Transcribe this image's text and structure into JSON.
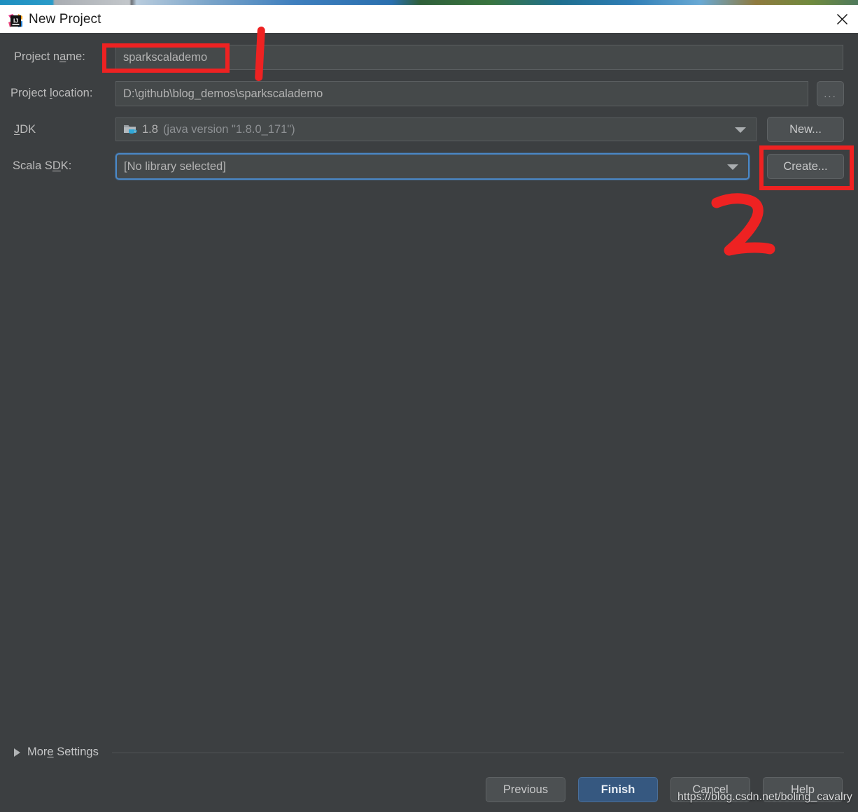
{
  "window": {
    "title": "New Project",
    "icon": "intellij-idea-logo",
    "close_icon": "close-icon"
  },
  "form": {
    "project_name": {
      "label_before": "Project n",
      "label_mnemonic": "a",
      "label_after": "me:",
      "value": "sparkscalademo"
    },
    "project_location": {
      "label_before": "Project ",
      "label_mnemonic": "l",
      "label_after": "ocation:",
      "value": "D:\\github\\blog_demos\\sparkscalademo",
      "browse_label": "..."
    },
    "jdk": {
      "label_before": "",
      "label_mnemonic": "J",
      "label_after": "DK",
      "value": "1.8",
      "value_detail": "(java version \"1.8.0_171\")",
      "icon": "jdk-folder-icon",
      "button_label": "New...",
      "arrow_icon": "chevron-down-icon"
    },
    "scala_sdk": {
      "label_before": "Scala S",
      "label_mnemonic": "D",
      "label_after": "K:",
      "value": "[No library selected]",
      "button_label": "Create...",
      "arrow_icon": "chevron-down-icon"
    }
  },
  "more_settings": {
    "label_before": "Mor",
    "label_mnemonic": "e",
    "label_after": " Settings",
    "expander_icon": "triangle-right-icon"
  },
  "footer": {
    "previous_label": "Previous",
    "finish_label": "Finish",
    "cancel_label": "Cancel",
    "help_label": "Help"
  },
  "annotations": {
    "step_one": "1",
    "step_two": "2",
    "accent_color": "#ee2222"
  },
  "watermark": {
    "text": "https://blog.csdn.net/boling_cavalry"
  },
  "colors": {
    "dialog_background": "#3c3f41",
    "titlebar_background": "#ffffff",
    "field_background": "#45494a",
    "focus_border": "#4a88c7",
    "primary_button": "#365880"
  }
}
